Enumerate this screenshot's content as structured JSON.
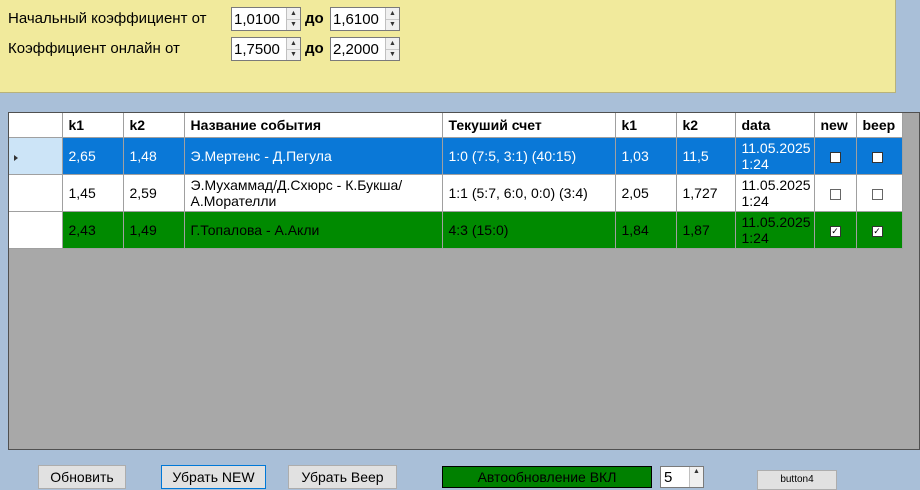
{
  "filters": {
    "initial": {
      "label": "Начальный коэффициент от",
      "from": "1,0100",
      "to_label": "до",
      "to": "1,6100"
    },
    "online": {
      "label": "Коэффициент онлайн от",
      "from": "1,7500",
      "to_label": "до",
      "to": "2,2000"
    }
  },
  "grid": {
    "columns": [
      "k1",
      "k2",
      "Название события",
      "Текуший счет",
      "k1",
      "k2",
      "data",
      "new",
      "beep"
    ],
    "rows": [
      {
        "k1": "2,65",
        "k2": "1,48",
        "event": "Э.Мертенс - Д.Пегула",
        "score": "1:0 (7:5, 3:1) (40:15)",
        "k1b": "1,03",
        "k2b": "11,5",
        "date": "11.05.2025 1:24",
        "new": false,
        "beep": false,
        "style": "blue"
      },
      {
        "k1": "1,45",
        "k2": "2,59",
        "event": "Э.Мухаммад/Д.Схюрс - К.Букша/А.Морателли",
        "score": "1:1 (5:7, 6:0, 0:0) (3:4)",
        "k1b": "2,05",
        "k2b": "1,727",
        "date": "11.05.2025 1:24",
        "new": false,
        "beep": false,
        "style": "white"
      },
      {
        "k1": "2,43",
        "k2": "1,49",
        "event": "Г.Топалова - А.Акли",
        "score": "4:3 (15:0)",
        "k1b": "1,84",
        "k2b": "1,87",
        "date": "11.05.2025 1:24",
        "new": true,
        "beep": true,
        "style": "green"
      }
    ]
  },
  "toolbar": {
    "refresh": "Обновить",
    "remove_new": "Убрать NEW",
    "remove_beep": "Убрать Beep",
    "auto_update": "Автообновление ВКЛ",
    "interval": "5",
    "button4": "button4"
  },
  "colors": {
    "panel": "#f1ea9c",
    "selected_row": "#0a78d7",
    "green_row": "#008a00",
    "background": "#a9bfd8"
  }
}
